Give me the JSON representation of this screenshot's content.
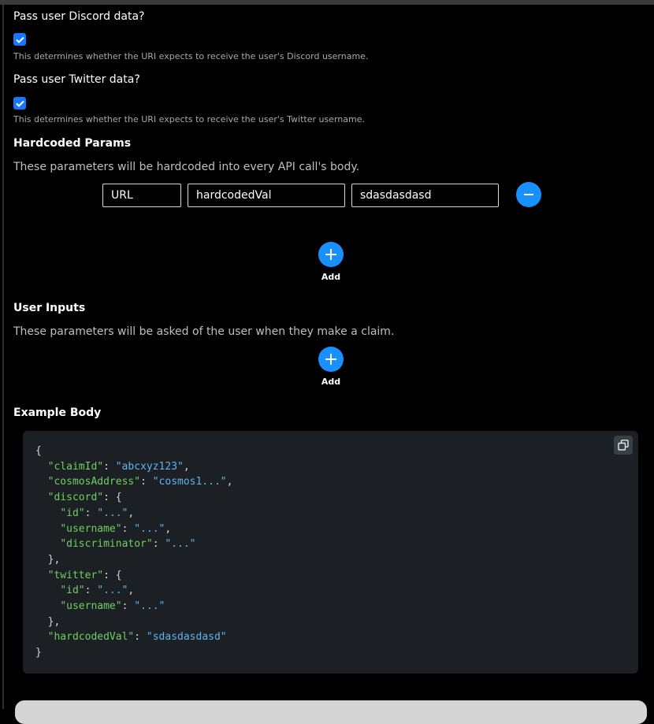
{
  "discord": {
    "question": "Pass user Discord data?",
    "checked": true,
    "hint": "This determines whether the URI expects to receive the user's Discord username."
  },
  "twitter": {
    "question": "Pass user Twitter data?",
    "checked": true,
    "hint": "This determines whether the URI expects to receive the user's Twitter username."
  },
  "hardcoded": {
    "title": "Hardcoded Params",
    "description": "These parameters will be hardcoded into every API call's body.",
    "row": {
      "type_value": "URL",
      "key_value": "hardcodedVal",
      "value_value": "sdasdasdasd"
    },
    "remove_icon": "minus-icon",
    "add_label": "Add"
  },
  "user_inputs": {
    "title": "User Inputs",
    "description": "These parameters will be asked of the user when they make a claim.",
    "add_label": "Add"
  },
  "example": {
    "title": "Example Body",
    "copy_icon": "copy-icon",
    "body": {
      "claimId": "abcxyz123",
      "cosmosAddress": "cosmos1...",
      "discord": {
        "id": "...",
        "username": "...",
        "discriminator": "..."
      },
      "twitter": {
        "id": "...",
        "username": "..."
      },
      "hardcodedVal": "sdasdasdasd"
    }
  },
  "colors": {
    "accent": "#1890ff",
    "checkbox": "#1677ff",
    "json_key": "#6fcf5e",
    "json_string": "#5fb3ef",
    "code_bg": "#1c2025"
  }
}
